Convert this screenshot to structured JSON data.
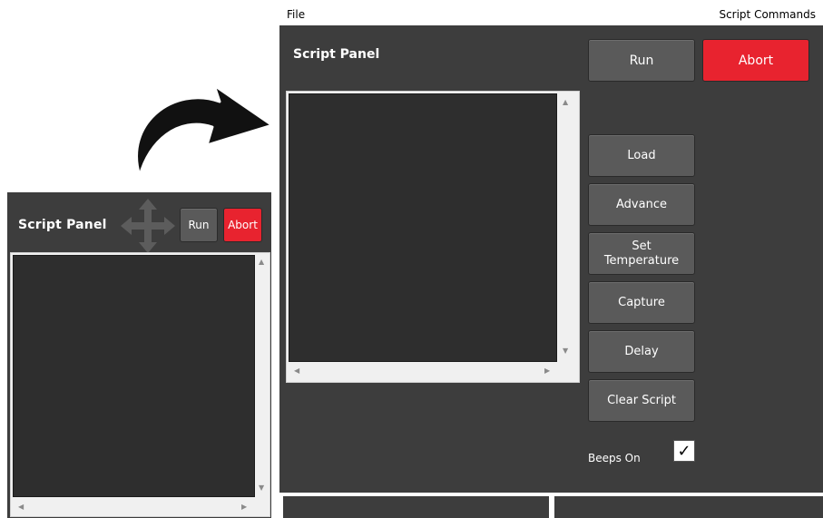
{
  "small_panel": {
    "title": "Script Panel",
    "run_label": "Run",
    "abort_label": "Abort",
    "move_icon": "move-arrows-icon"
  },
  "menu": {
    "file": "File",
    "script_commands": "Script Commands"
  },
  "big_panel": {
    "title": "Script Panel",
    "run_label": "Run",
    "abort_label": "Abort",
    "commands": {
      "load": "Load",
      "advance": "Advance",
      "set_temperature_line1": "Set",
      "set_temperature_line2": "Temperature",
      "capture": "Capture",
      "delay": "Delay",
      "clear_script": "Clear Script"
    },
    "beeps_label": "Beeps On",
    "beeps_checked": true,
    "check_glyph": "✓"
  },
  "colors": {
    "panel_bg": "#3d3d3d",
    "editor_bg": "#2e2e2e",
    "button_gray": "#5a5a5a",
    "abort_red": "#e8232f"
  }
}
